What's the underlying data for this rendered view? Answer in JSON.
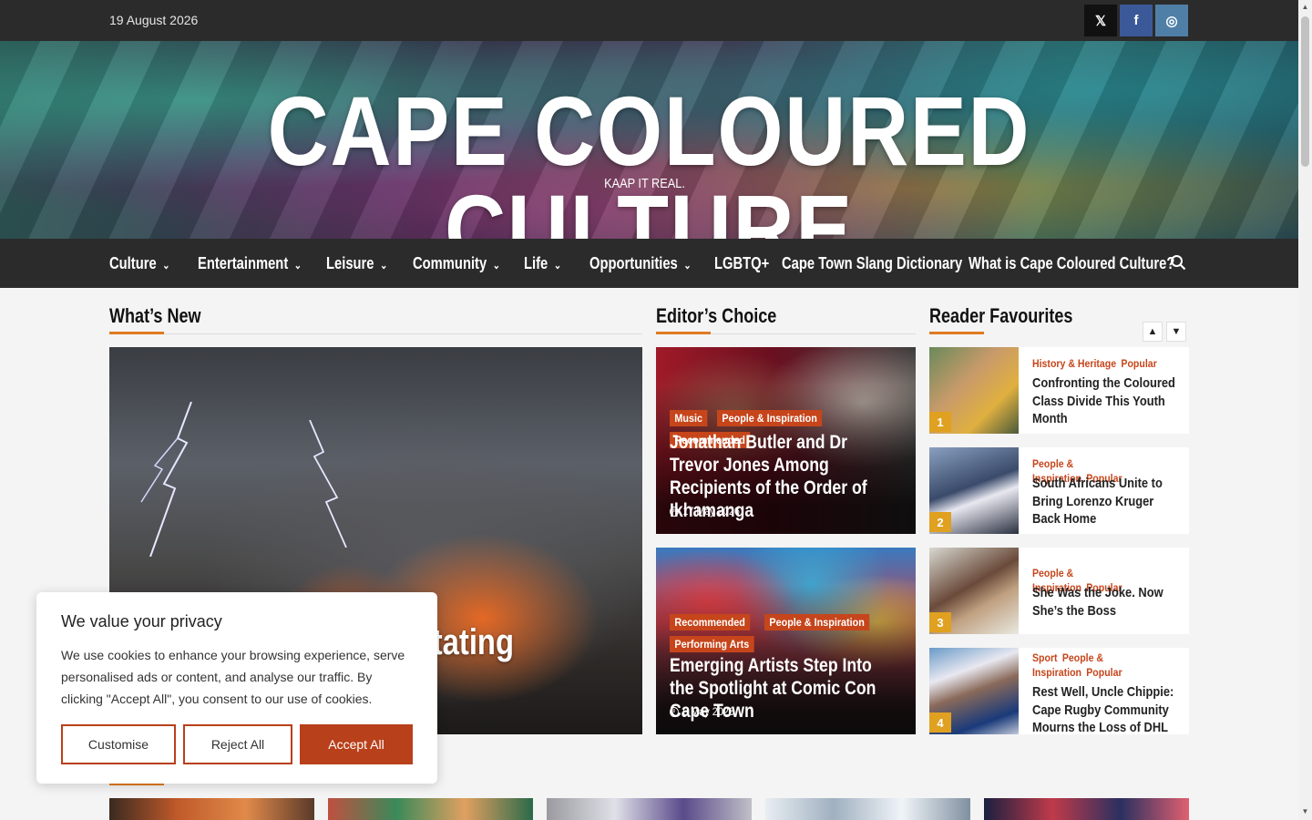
{
  "topbar": {
    "date": "19 August 2026",
    "social": [
      {
        "name": "x",
        "glyph": "𝕏"
      },
      {
        "name": "facebook",
        "glyph": "f"
      },
      {
        "name": "instagram",
        "glyph": "◎"
      }
    ]
  },
  "header": {
    "title": "CAPE COLOURED CULTURE",
    "tagline": "KAAP IT REAL."
  },
  "nav": {
    "items": [
      {
        "label": "Culture",
        "dropdown": true
      },
      {
        "label": "Entertainment",
        "dropdown": true
      },
      {
        "label": "Leisure",
        "dropdown": true
      },
      {
        "label": "Community",
        "dropdown": true
      },
      {
        "label": "Life",
        "dropdown": true
      },
      {
        "label": "Opportunities",
        "dropdown": true
      },
      {
        "label": "LGBTQ+",
        "dropdown": false
      },
      {
        "label": "Cape Town Slang Dictionary",
        "dropdown": false
      },
      {
        "label": "What is Cape Coloured Culture?",
        "dropdown": false
      }
    ],
    "chevron": "⌄"
  },
  "sections": {
    "whats_new": "What’s New",
    "editors_choice": "Editor’s Choice",
    "reader_favourites": "Reader Favourites"
  },
  "whats_new": {
    "headline_visible": "vastating"
  },
  "editors_choice": [
    {
      "tags": [
        "Music",
        "People & Inspiration",
        "Recommended"
      ],
      "title": "Jonathan Butler and Dr Trevor Jones Among Recipients of the Order of Ikhamanga",
      "date": "17 May 2026"
    },
    {
      "tags": [
        "Recommended",
        "People & Inspiration",
        "Performing Arts"
      ],
      "title": "Emerging Artists Step Into the Spotlight at Comic Con Cape Town",
      "date": "6 May 2026"
    }
  ],
  "reader_favourites": {
    "up": "▲",
    "down": "▼",
    "items": [
      {
        "num": "1",
        "cats": [
          "History & Heritage",
          "Popular"
        ],
        "title": "Confronting the Coloured Class Divide This Youth Month"
      },
      {
        "num": "2",
        "cats": [
          "People & Inspiration",
          "Popular"
        ],
        "title": "South Africans Unite to Bring Lorenzo Kruger Back Home"
      },
      {
        "num": "3",
        "cats": [
          "People & Inspiration",
          "Popular"
        ],
        "title": "She Was the Joke. Now She’s the Boss"
      },
      {
        "num": "4",
        "cats": [
          "Sport",
          "People & Inspiration",
          "Popular"
        ],
        "title": "Rest Well, Uncle Chippie: Cape Rugby Community Mourns the Loss of DHL"
      }
    ]
  },
  "cookie": {
    "title": "We value your privacy",
    "body": "We use cookies to enhance your browsing experience, serve personalised ads or content, and analyse our traffic. By clicking \"Accept All\", you consent to our use of cookies.",
    "customise": "Customise",
    "reject": "Reject All",
    "accept": "Accept All"
  },
  "colors": {
    "accent": "#c6451b",
    "underline": "#e07a20",
    "dark": "#2b2b2b",
    "rank_badge": "#e0a020"
  },
  "icons": {
    "search": "search-icon",
    "clock": "clock-icon",
    "chevron": "chevron-down-icon"
  }
}
